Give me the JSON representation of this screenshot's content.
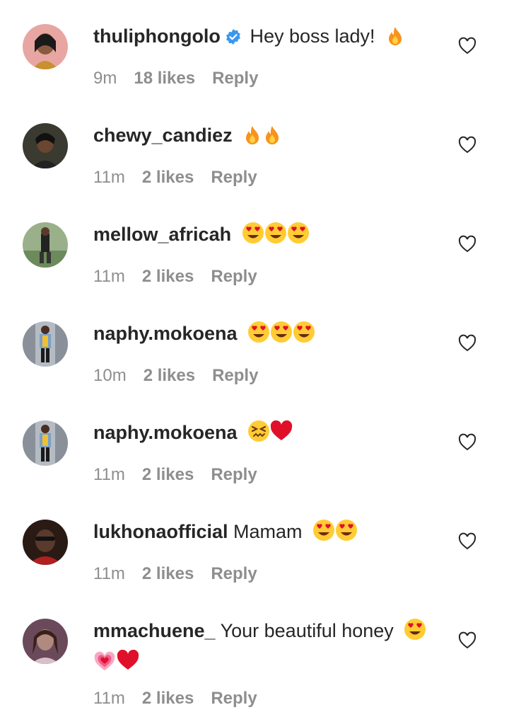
{
  "comments": [
    {
      "username": "thuliphongolo",
      "verified": true,
      "text": "Hey boss lady!",
      "emojis": [
        "fire"
      ],
      "time": "9m",
      "likes": "18 likes",
      "reply": "Reply",
      "avatar_color": "#e8a6a2"
    },
    {
      "username": "chewy_candiez",
      "verified": false,
      "text": "",
      "emojis": [
        "fire",
        "fire"
      ],
      "time": "11m",
      "likes": "2 likes",
      "reply": "Reply",
      "avatar_color": "#3a3a30"
    },
    {
      "username": "mellow_africah",
      "verified": false,
      "text": "",
      "emojis": [
        "heart-eyes",
        "heart-eyes",
        "heart-eyes"
      ],
      "time": "11m",
      "likes": "2 likes",
      "reply": "Reply",
      "avatar_color": "#6d8a5c"
    },
    {
      "username": "naphy.mokoena",
      "verified": false,
      "text": "",
      "emojis": [
        "heart-eyes",
        "heart-eyes",
        "heart-eyes"
      ],
      "time": "10m",
      "likes": "2 likes",
      "reply": "Reply",
      "avatar_color": "#8a9099"
    },
    {
      "username": "naphy.mokoena",
      "verified": false,
      "text": "",
      "emojis": [
        "confounded",
        "red-heart"
      ],
      "time": "11m",
      "likes": "2 likes",
      "reply": "Reply",
      "avatar_color": "#8a9099"
    },
    {
      "username": "lukhonaofficial",
      "verified": false,
      "text": "Mamam",
      "emojis": [
        "heart-eyes",
        "heart-eyes"
      ],
      "time": "11m",
      "likes": "2 likes",
      "reply": "Reply",
      "avatar_color": "#5a3a2c"
    },
    {
      "username": "mmachuene_",
      "verified": false,
      "text": "Your beautiful honey",
      "emojis": [
        "heart-eyes"
      ],
      "second_line_emojis": [
        "growing-heart",
        "red-heart"
      ],
      "time": "11m",
      "likes": "2 likes",
      "reply": "Reply",
      "avatar_color": "#b08a7e"
    }
  ],
  "colors": {
    "text": "#262626",
    "meta": "#8e8e8e",
    "verified": "#3897f0",
    "heart_red": "#e0102a",
    "emoji_yellow": "#ffcc33"
  }
}
